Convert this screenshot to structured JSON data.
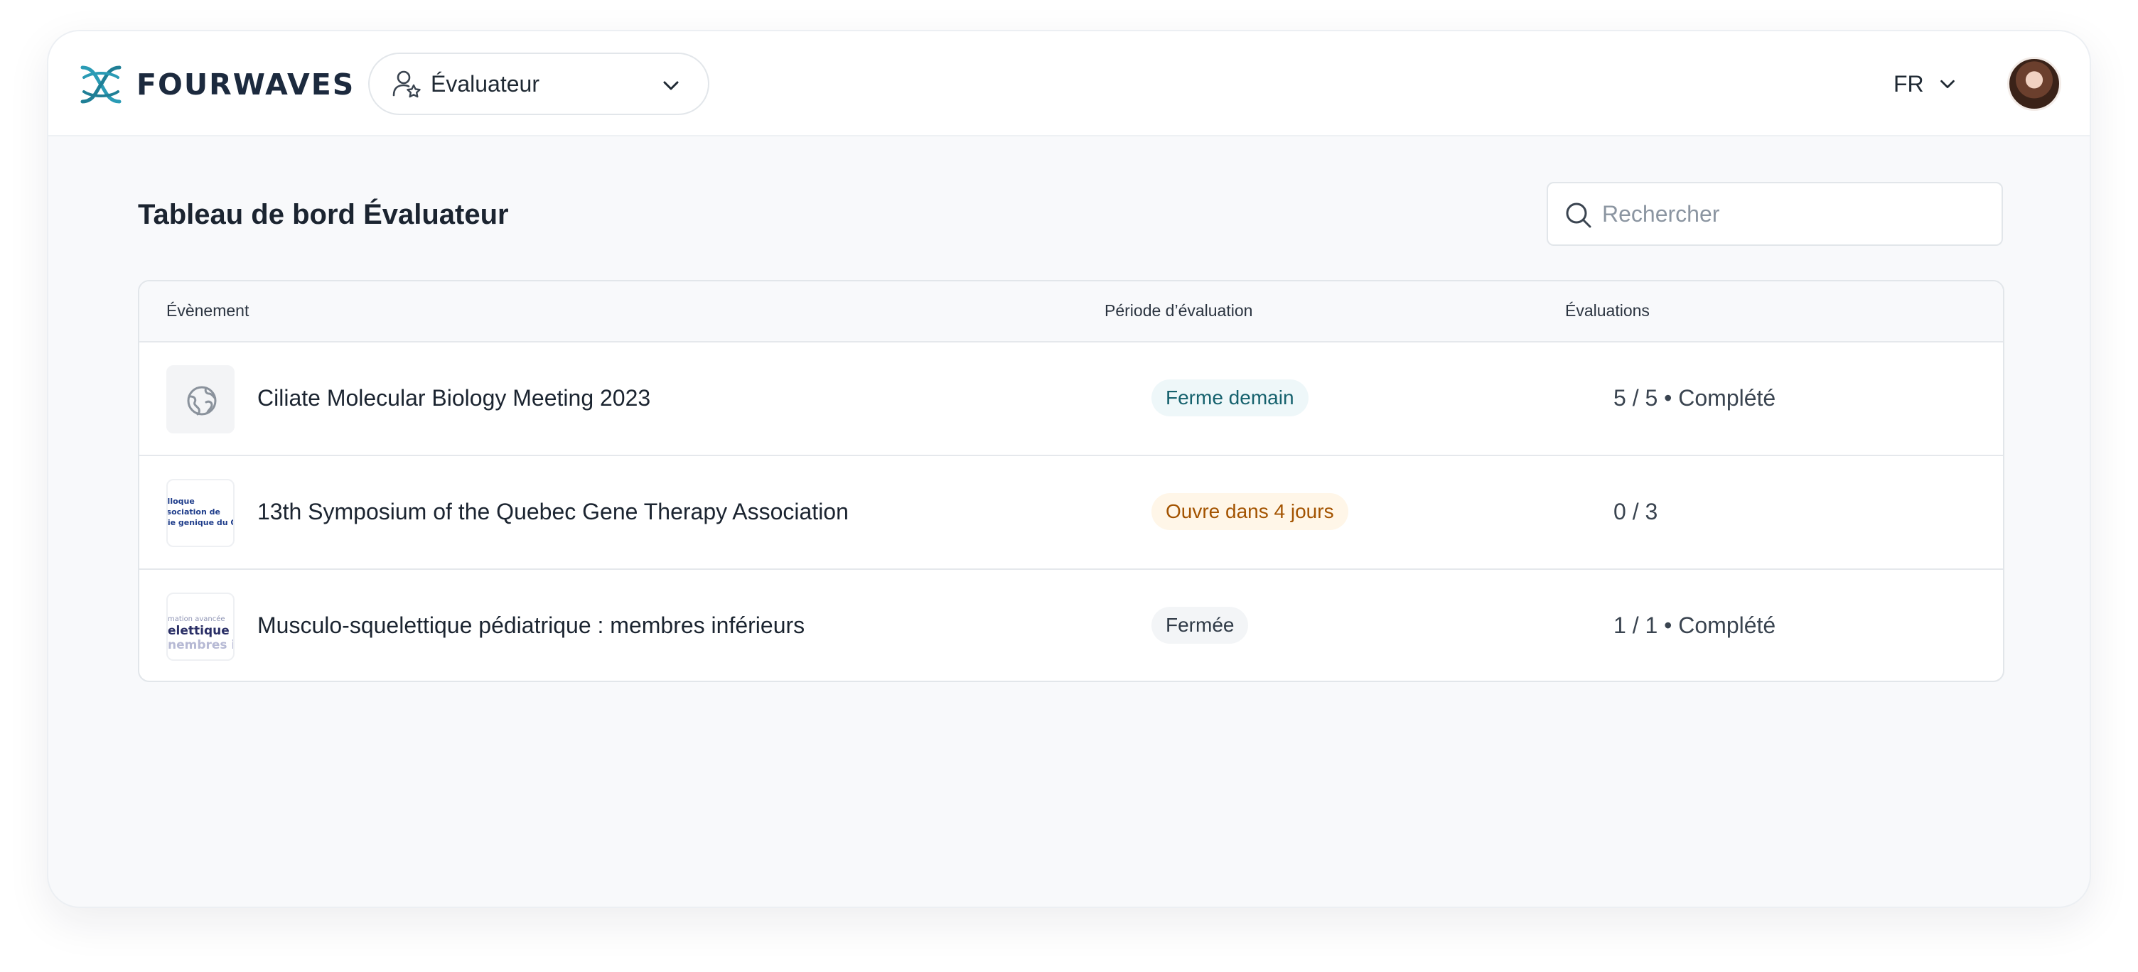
{
  "app": {
    "brand": "FOURWAVES",
    "brand_color": "#2a9bb5",
    "role_selector": {
      "label": "Évaluateur",
      "icon": "user-star-icon"
    },
    "language": {
      "label": "FR"
    }
  },
  "page": {
    "title": "Tableau de bord Évaluateur",
    "search": {
      "placeholder": "Rechercher",
      "value": ""
    }
  },
  "table": {
    "headers": {
      "event": "Évènement",
      "period": "Période d’évaluation",
      "evaluations": "Évaluations"
    },
    "rows": [
      {
        "thumbnail": {
          "type": "placeholder",
          "icon": "globe-icon"
        },
        "name": "Ciliate Molecular Biology Meeting 2023",
        "status": "Ferme demain",
        "status_color": "#15616d",
        "evaluations": "5 / 5 • Complété"
      },
      {
        "thumbnail": {
          "type": "image",
          "lines": [
            "olloque",
            "ssociation de",
            "pie genique du Q"
          ]
        },
        "name": "13th Symposium of the Quebec Gene Therapy Association",
        "status": "Ouvre dans 4 jours",
        "status_color": "#a35300",
        "evaluations": "0 / 3"
      },
      {
        "thumbnail": {
          "type": "image",
          "lines": [
            "mation avancée",
            "elettique p",
            "nembres in"
          ]
        },
        "name": "Musculo-squelettique pédiatrique : membres inférieurs",
        "status": "Fermée",
        "status_color": "#2f3a46",
        "evaluations": "1 / 1 • Complété"
      }
    ]
  }
}
